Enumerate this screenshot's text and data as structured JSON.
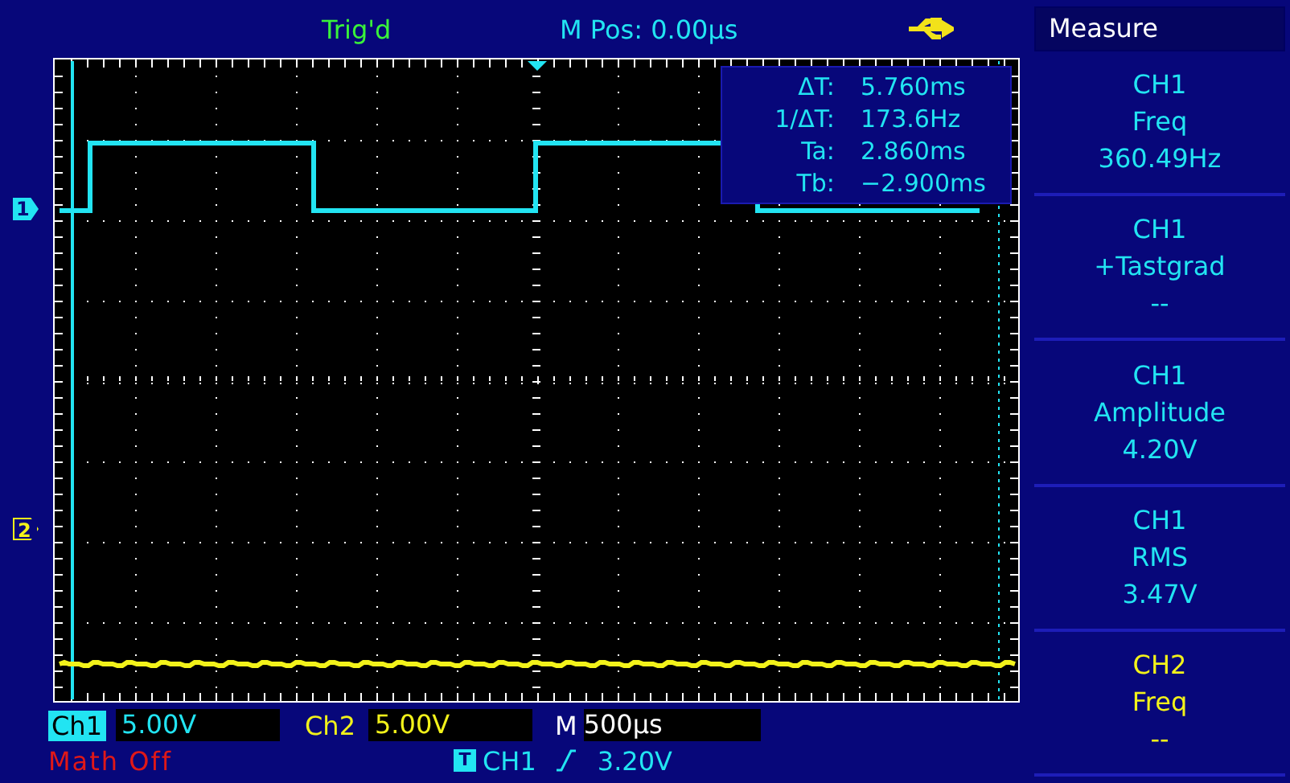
{
  "status": {
    "trigger": "Trig'd",
    "position": "M Pos: 0.00µs"
  },
  "cursor_readout": [
    {
      "label": "ΔT:",
      "value": "5.760ms"
    },
    {
      "label": "1/ΔT:",
      "value": "173.6Hz"
    },
    {
      "label": "Ta:",
      "value": "2.860ms"
    },
    {
      "label": "Tb:",
      "value": "−2.900ms"
    }
  ],
  "channel_markers": [
    {
      "label": "1",
      "color": "#22e4f2"
    },
    {
      "label": "2",
      "color": "#f2f21a"
    }
  ],
  "measure": {
    "title": "Measure",
    "items": [
      {
        "channel": "CH1",
        "name": "Freq",
        "value": "360.49Hz",
        "color": "#22e4f2"
      },
      {
        "channel": "CH1",
        "name": "+Tastgrad",
        "value": "--",
        "color": "#22e4f2"
      },
      {
        "channel": "CH1",
        "name": "Amplitude",
        "value": "4.20V",
        "color": "#22e4f2"
      },
      {
        "channel": "CH1",
        "name": "RMS",
        "value": "3.47V",
        "color": "#22e4f2"
      },
      {
        "channel": "CH2",
        "name": "Freq",
        "value": "--",
        "color": "#f2f21a"
      }
    ]
  },
  "channels": [
    {
      "label": "Ch1",
      "scale": "5.00V",
      "selected": true,
      "color": "#22e4f2"
    },
    {
      "label": "Ch2",
      "scale": "5.00V",
      "selected": false,
      "color": "#f2f21a"
    }
  ],
  "timebase": {
    "label": "M",
    "value": "500µs"
  },
  "math": "Math Off",
  "trigger": {
    "badge": "T",
    "source": "CH1",
    "level": "3.20V"
  }
}
